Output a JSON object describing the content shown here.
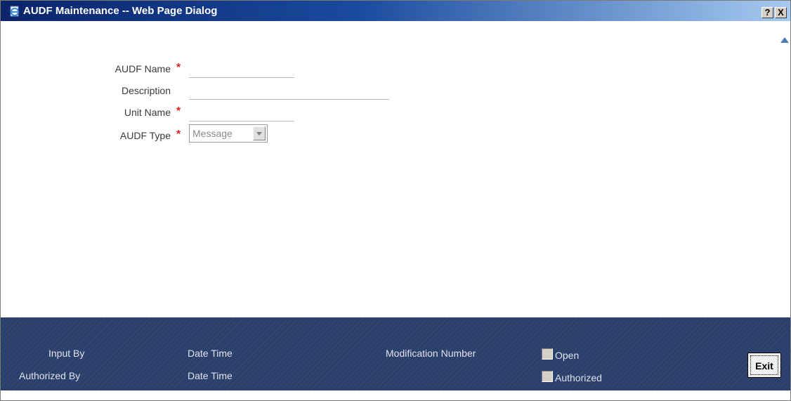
{
  "window": {
    "title": "AUDF Maintenance -- Web Page Dialog",
    "help_label": "?",
    "close_label": "X"
  },
  "form": {
    "audf_name": {
      "label": "AUDF Name",
      "required_mark": "*",
      "value": ""
    },
    "description": {
      "label": "Description",
      "value": ""
    },
    "unit_name": {
      "label": "Unit Name",
      "required_mark": "*",
      "value": ""
    },
    "audf_type": {
      "label": "AUDF Type",
      "required_mark": "*",
      "selected": "Message"
    }
  },
  "footer": {
    "input_by": "Input By",
    "authorized_by": "Authorized By",
    "date_time_1": "Date Time",
    "date_time_2": "Date Time",
    "modification_number": "Modification Number",
    "open_label": "Open",
    "authorized_label": "Authorized",
    "exit_label": "Exit"
  },
  "colors": {
    "title_gradient_start": "#0a246a",
    "footer_bg": "#2b3f6b",
    "required": "#e02020"
  },
  "icons": {
    "app_icon": "ie-page-icon",
    "help": "help-icon",
    "close": "close-icon",
    "scroll_up": "arrow-up-icon",
    "scroll_down": "arrow-down-icon",
    "dropdown": "chevron-down-icon"
  }
}
